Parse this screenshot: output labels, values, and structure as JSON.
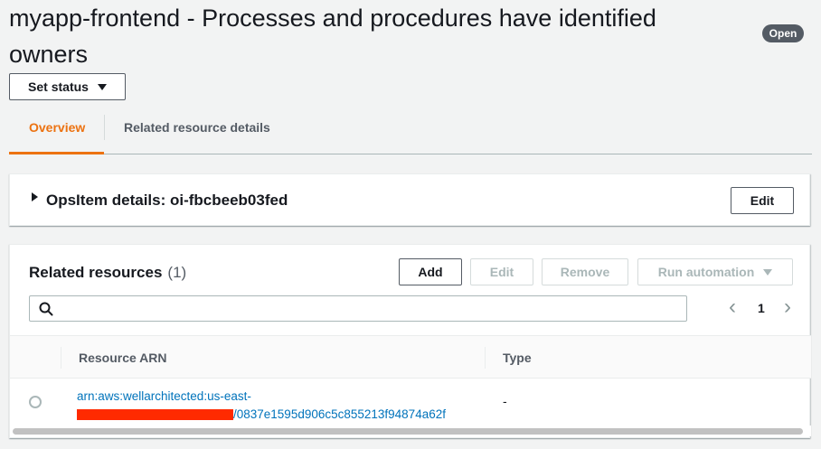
{
  "header": {
    "title": "myapp-frontend - Processes and procedures have identified owners",
    "status_badge": "Open",
    "set_status_label": "Set status"
  },
  "tabs": [
    {
      "label": "Overview",
      "active": true
    },
    {
      "label": "Related resource details",
      "active": false
    }
  ],
  "opsitem_panel": {
    "title": "OpsItem details: oi-fbcbeeb03fed",
    "edit_label": "Edit"
  },
  "related_resources": {
    "title": "Related resources",
    "count": "(1)",
    "buttons": {
      "add": "Add",
      "edit": "Edit",
      "remove": "Remove",
      "run_automation": "Run automation"
    },
    "search": {
      "placeholder": "",
      "value": ""
    },
    "pagination": {
      "prev": "‹",
      "page": "1",
      "next": "›"
    },
    "columns": [
      "Resource ARN",
      "Type"
    ],
    "rows": [
      {
        "arn_line1": "arn:aws:wellarchitected:us-east-",
        "arn_line2": "/0837e1595d906c5c855213f94874a62f",
        "type": "-"
      }
    ]
  },
  "colors": {
    "accent": "#ec7211",
    "link": "#0073bb",
    "badge": "#545b64",
    "redaction": "#ff2a00"
  }
}
